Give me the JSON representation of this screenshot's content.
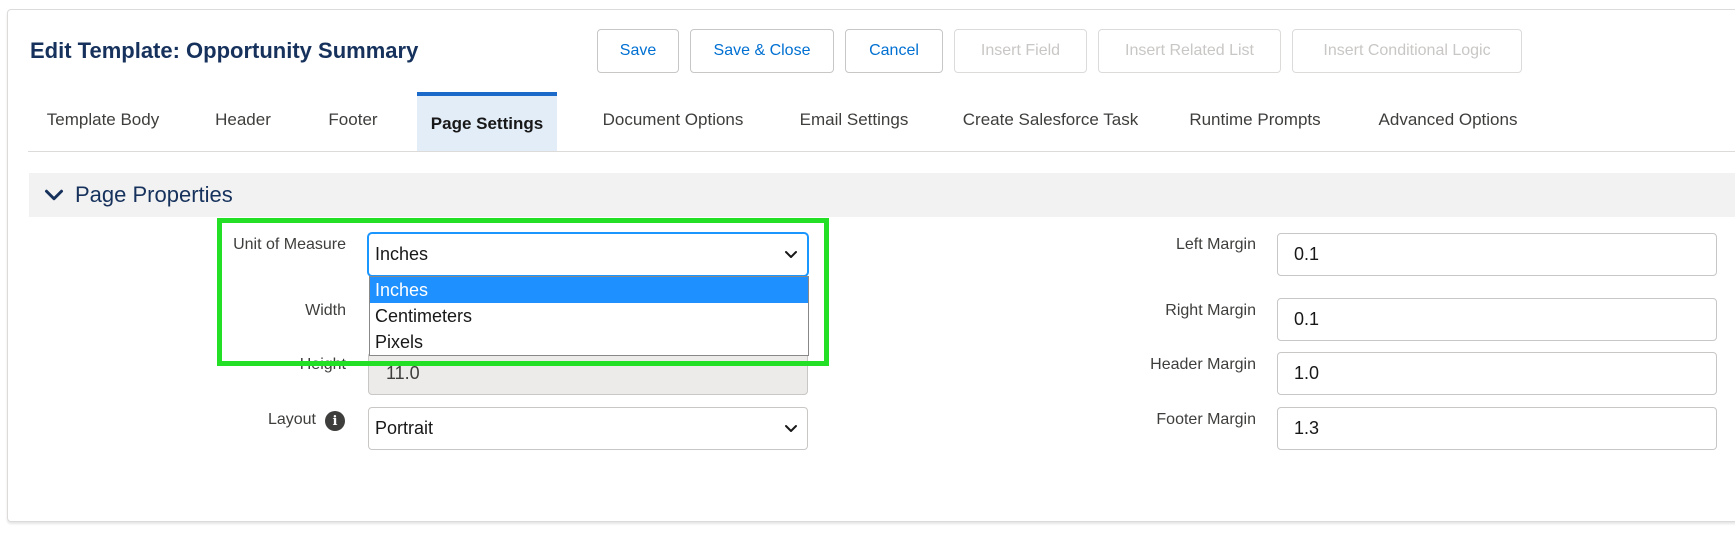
{
  "header": {
    "title": "Edit Template: Opportunity Summary"
  },
  "toolbar": {
    "save": "Save",
    "save_close": "Save & Close",
    "cancel": "Cancel",
    "insert_field": "Insert Field",
    "insert_related_list": "Insert Related List",
    "insert_conditional_logic": "Insert Conditional Logic"
  },
  "tabs": [
    {
      "label": "Template Body"
    },
    {
      "label": "Header"
    },
    {
      "label": "Footer"
    },
    {
      "label": "Page Settings",
      "active": true
    },
    {
      "label": "Document Options"
    },
    {
      "label": "Email Settings"
    },
    {
      "label": "Create Salesforce Task"
    },
    {
      "label": "Runtime Prompts"
    },
    {
      "label": "Advanced Options"
    }
  ],
  "section": {
    "title": "Page Properties"
  },
  "left_fields": {
    "unit_label": "Unit of Measure",
    "unit_value": "Inches",
    "unit_options": [
      "Inches",
      "Centimeters",
      "Pixels"
    ],
    "width_label": "Width",
    "height_label": "Height",
    "height_value": "11.0",
    "layout_label": "Layout",
    "layout_value": "Portrait"
  },
  "right_fields": {
    "left_margin_label": "Left Margin",
    "left_margin_value": "0.1",
    "right_margin_label": "Right Margin",
    "right_margin_value": "0.1",
    "header_margin_label": "Header Margin",
    "header_margin_value": "1.0",
    "footer_margin_label": "Footer Margin",
    "footer_margin_value": "1.3"
  },
  "colors": {
    "brand_blue": "#0070d2",
    "title_navy": "#16325c",
    "highlight_green": "#23e026",
    "selected_option": "#1e90ff"
  },
  "icons": {
    "section_toggle": "chevron-down-icon",
    "select_caret": "chevron-down-icon",
    "layout_help": "info-icon"
  }
}
